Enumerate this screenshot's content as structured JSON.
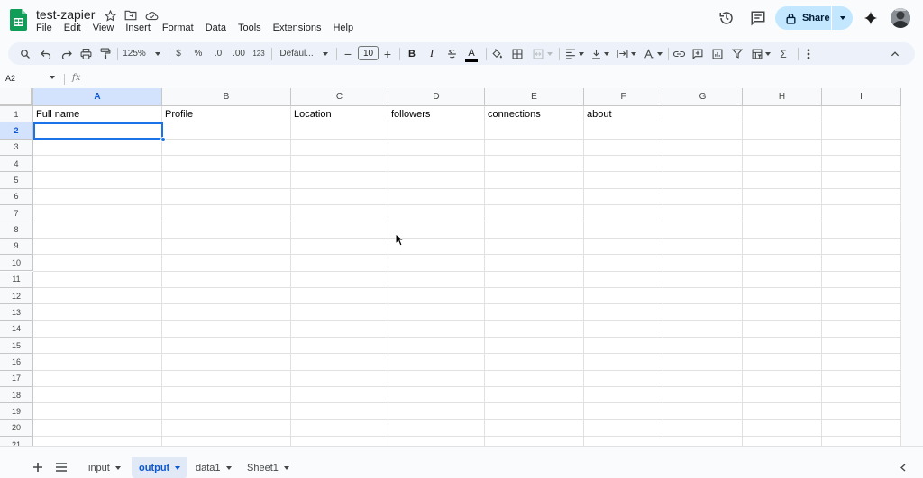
{
  "header": {
    "doc_title": "test-zapier",
    "menu": [
      "File",
      "Edit",
      "View",
      "Insert",
      "Format",
      "Data",
      "Tools",
      "Extensions",
      "Help"
    ],
    "share_label": "Share"
  },
  "toolbar": {
    "zoom": "125%",
    "currency": "$",
    "percent": "%",
    "dec_decrease": ".0",
    "dec_increase": ".00",
    "number_format": "123",
    "font": "Defaul...",
    "font_size": "10",
    "bold": "B",
    "italic": "I",
    "text_color": "A"
  },
  "formula_bar": {
    "name_box": "A2",
    "fx": "fx",
    "content": ""
  },
  "grid": {
    "columns": [
      "A",
      "B",
      "C",
      "D",
      "E",
      "F",
      "G",
      "H",
      "I"
    ],
    "selected_column": "A",
    "rows": [
      "1",
      "2",
      "3",
      "4",
      "5",
      "6",
      "7",
      "8",
      "9",
      "10",
      "11",
      "12",
      "13",
      "14",
      "15",
      "16",
      "17",
      "18",
      "19",
      "20",
      "21"
    ],
    "selected_row": "2",
    "header_row": [
      "Full name",
      "Profile",
      "Location",
      "followers",
      "connections",
      "about"
    ]
  },
  "sheets": {
    "tabs": [
      "input",
      "output",
      "data1",
      "Sheet1"
    ],
    "active": "output"
  },
  "colors": {
    "accent": "#0b57d0",
    "share_bg": "#c2e7ff",
    "selection": "#1a73e8",
    "sheets_green": "#0f9d58"
  }
}
